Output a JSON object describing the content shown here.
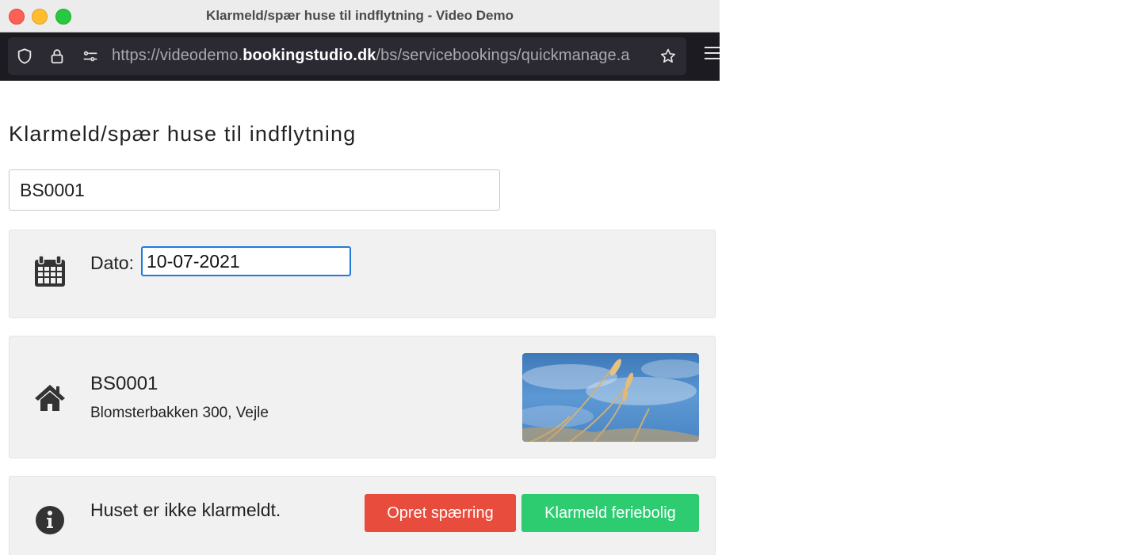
{
  "window": {
    "title": "Klarmeld/spær huse til indflytning - Video Demo"
  },
  "browser": {
    "url_prefix": "https://videodemo.",
    "url_domain": "bookingstudio.dk",
    "url_path": "/bs/servicebookings/quickmanage.a"
  },
  "page": {
    "title": "Klarmeld/spær huse til indflytning",
    "house_input_value": "BS0001",
    "date": {
      "label": "Dato:",
      "value": "10-07-2021"
    },
    "house": {
      "code": "BS0001",
      "address": "Blomsterbakken 300, Vejle"
    },
    "status": {
      "text": "Huset er ikke klarmeldt.",
      "block_button": "Opret spærring",
      "ready_button": "Klarmeld feriebolig"
    }
  },
  "colors": {
    "block_button": "#e74c3c",
    "ready_button": "#2ecc71",
    "date_input_focus": "#1f7ae0"
  },
  "icons": [
    "shield-icon",
    "lock-icon",
    "permissions-icon",
    "bookmark-star-icon",
    "menu-icon",
    "calendar-icon",
    "home-icon",
    "info-icon"
  ]
}
